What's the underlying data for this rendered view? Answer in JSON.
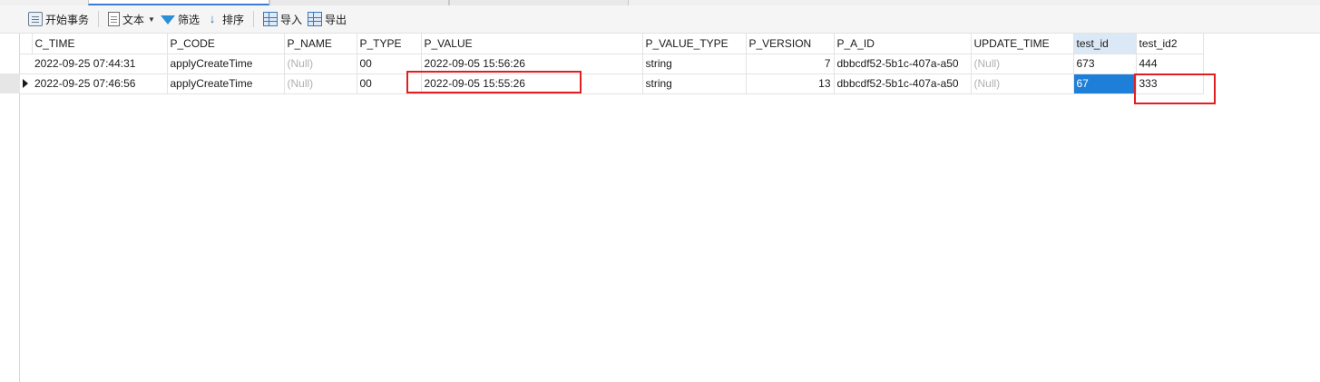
{
  "toolbar": {
    "begin_transaction": "开始事务",
    "text": "文本",
    "filter": "筛选",
    "sort": "排序",
    "import": "导入",
    "export": "导出"
  },
  "columns": [
    "C_TIME",
    "P_CODE",
    "P_NAME",
    "P_TYPE",
    "P_VALUE",
    "P_VALUE_TYPE",
    "P_VERSION",
    "P_A_ID",
    "UPDATE_TIME",
    "test_id",
    "test_id2"
  ],
  "rows": [
    [
      "2022-09-25 07:44:31",
      "applyCreateTime",
      "(Null)",
      "00",
      "2022-09-05 15:56:26",
      "string",
      "7",
      "dbbcdf52-5b1c-407a-a50",
      "(Null)",
      "673",
      "444"
    ],
    [
      "2022-09-25 07:46:56",
      "applyCreateTime",
      "(Null)",
      "00",
      "2022-09-05 15:55:26",
      "string",
      "13",
      "dbbcdf52-5b1c-407a-a50",
      "(Null)",
      "67",
      "333"
    ]
  ],
  "colors": {
    "selection": "#1e7fd8",
    "highlight_box": "#e02020",
    "null_text": "#b0b0b0"
  }
}
